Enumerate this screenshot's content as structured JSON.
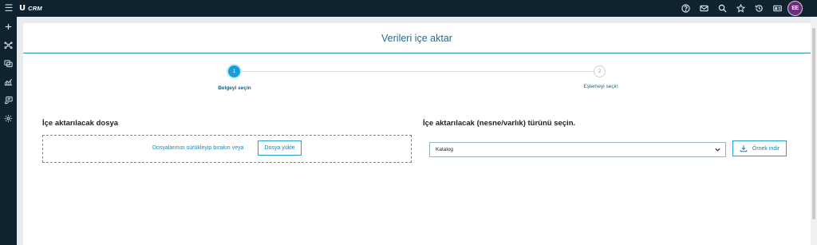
{
  "app": {
    "brand_logo": "U",
    "brand_name": "CRM",
    "menu_icon": "hamburger-icon",
    "header_icons": [
      "help-icon",
      "mail-icon",
      "search-icon",
      "star-icon",
      "history-icon",
      "id-card-icon"
    ],
    "avatar_initials": "EE",
    "side_icons": [
      "plus-icon",
      "network-icon",
      "sales-icon",
      "chart-icon",
      "support-icon",
      "settings-icon"
    ]
  },
  "page": {
    "title": "Verileri içe aktar"
  },
  "stepper": {
    "steps": [
      {
        "number": "1",
        "label": "Belgeyi seçin",
        "state": "active"
      },
      {
        "number": "2",
        "label": "Eşlemeyi seçin",
        "state": "inactive"
      }
    ]
  },
  "upload": {
    "title": "İçe aktarılacak dosya",
    "drop_text": "Dosyalarınızı sürükleyip bırakın veya",
    "button_label": "Dosya yükle"
  },
  "type_select": {
    "title": "İçe aktarılacak (nesne/varlık) türünü seçin.",
    "selected_value": "Katalog",
    "sample_button_label": "Örnek indir"
  },
  "colors": {
    "topbar": "#0e2230",
    "accent": "#1b9dd3",
    "title_blue": "#1a6e95",
    "avatar": "#6b2f79"
  }
}
